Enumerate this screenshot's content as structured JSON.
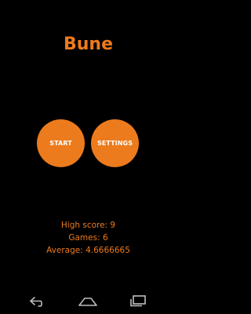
{
  "app": {
    "title": "Bune",
    "accent_color": "#ec7b1d",
    "background_color": "#000000"
  },
  "buttons": {
    "start_label": "START",
    "settings_label": "SETTINGS"
  },
  "stats": {
    "high_score": "High score: 9",
    "games": "Games: 6",
    "average": "Average: 4.6666665"
  },
  "nav_bar": {
    "back_icon": "back-icon",
    "home_icon": "home-icon",
    "recents_icon": "recents-icon"
  }
}
